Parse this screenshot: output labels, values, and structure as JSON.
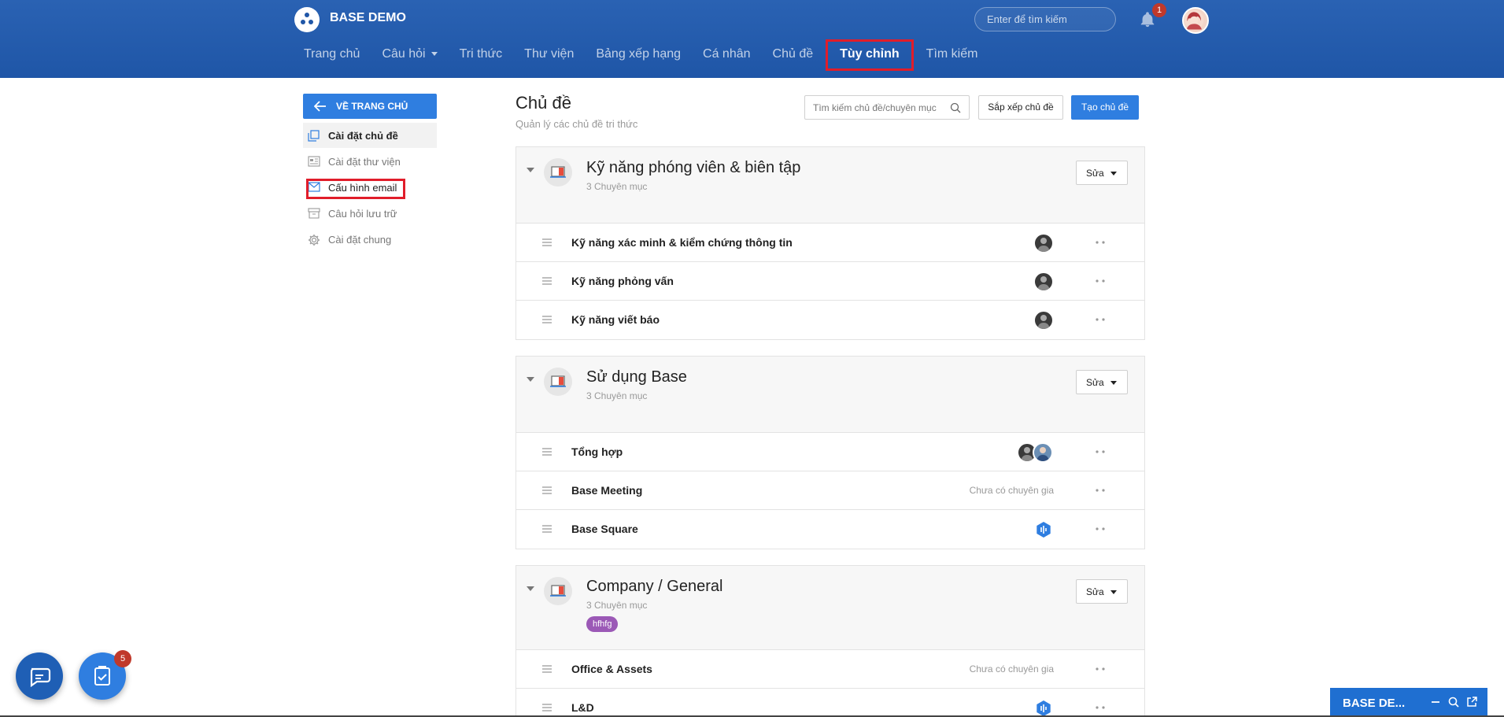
{
  "app": {
    "title": "BASE DEMO"
  },
  "header": {
    "search_placeholder": "Enter để tìm kiếm",
    "notification_count": "1"
  },
  "nav": [
    {
      "label": "Trang chủ"
    },
    {
      "label": "Câu hỏi"
    },
    {
      "label": "Tri thức"
    },
    {
      "label": "Thư viện"
    },
    {
      "label": "Bảng xếp hạng"
    },
    {
      "label": "Cá nhân"
    },
    {
      "label": "Chủ đề"
    },
    {
      "label": "Tùy chỉnh",
      "active": true
    },
    {
      "label": "Tìm kiếm"
    }
  ],
  "sidebar": {
    "back_label": "VỀ TRANG CHỦ",
    "items": [
      {
        "label": "Cài đặt chủ đề",
        "icon": "copy-icon",
        "active": true
      },
      {
        "label": "Cài đặt thư viện",
        "icon": "library-icon"
      },
      {
        "label": "Cấu hình email",
        "icon": "mail-icon",
        "highlighted": true
      },
      {
        "label": "Câu hỏi lưu trữ",
        "icon": "archive-icon"
      },
      {
        "label": "Cài đặt chung",
        "icon": "gear-icon"
      }
    ]
  },
  "main": {
    "title": "Chủ đề",
    "subtitle": "Quản lý các chủ đề tri thức",
    "search_placeholder": "Tìm kiếm chủ đề/chuyên mục",
    "sort_label": "Sắp xếp chủ đề",
    "create_label": "Tạo chủ đề",
    "edit_label": "Sửa",
    "no_expert_label": "Chưa có chuyên gia"
  },
  "topics": [
    {
      "name": "Kỹ năng phóng viên & biên tập",
      "count": "3 Chuyên mục",
      "categories": [
        {
          "name": "Kỹ năng xác minh & kiểm chứng thông tin",
          "experts": [
            "person"
          ]
        },
        {
          "name": "Kỹ năng phỏng vấn",
          "experts": [
            "person"
          ]
        },
        {
          "name": "Kỹ năng viết báo",
          "experts": [
            "person"
          ]
        }
      ]
    },
    {
      "name": "Sử dụng Base",
      "count": "3 Chuyên mục",
      "categories": [
        {
          "name": "Tổng hợp",
          "experts": [
            "person",
            "person"
          ]
        },
        {
          "name": "Base Meeting",
          "experts": []
        },
        {
          "name": "Base Square",
          "experts": [
            "base-logo"
          ]
        }
      ]
    },
    {
      "name": "Company / General",
      "count": "3 Chuyên mục",
      "tag": "hfhfg",
      "categories": [
        {
          "name": "Office & Assets",
          "experts": []
        },
        {
          "name": "L&D",
          "experts": [
            "base-logo"
          ]
        }
      ]
    }
  ],
  "floating": {
    "task_badge": "5",
    "mini_window_title": "BASE DE..."
  },
  "colors": {
    "header_blue": "#1f56a7",
    "primary_button": "#2f7ee0",
    "highlight_red": "#e11d2a",
    "badge_red": "#c0392b",
    "tag_purple": "#9b59b6"
  }
}
